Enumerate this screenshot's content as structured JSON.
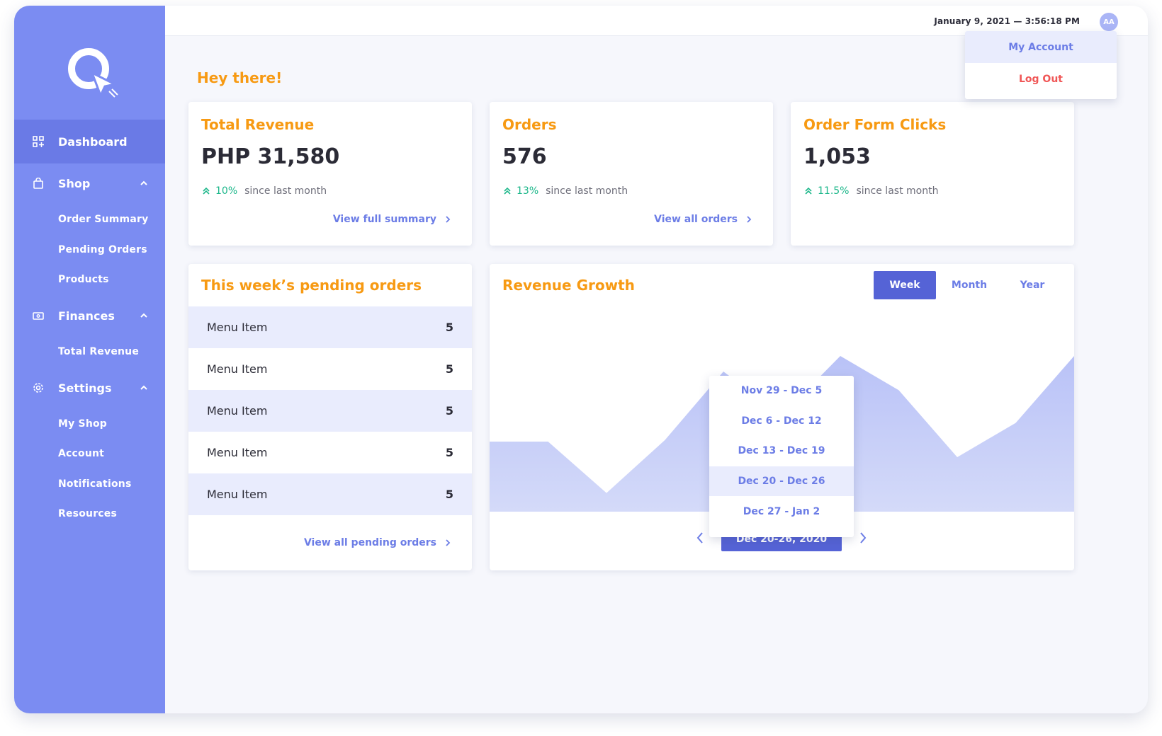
{
  "sidebar": {
    "items": [
      {
        "label": "Dashboard",
        "icon": "dashboard-icon"
      },
      {
        "label": "Shop",
        "icon": "shopping-bag-icon",
        "sub": [
          "Order Summary",
          "Pending Orders",
          "Products"
        ]
      },
      {
        "label": "Finances",
        "icon": "wallet-icon",
        "sub": [
          "Total Revenue"
        ]
      },
      {
        "label": "Settings",
        "icon": "gear-icon",
        "sub": [
          "My Shop",
          "Account",
          "Notifications",
          "Resources"
        ]
      }
    ]
  },
  "topbar": {
    "date": "January 9, 2021",
    "separator": "—",
    "time": "3:56:18 PM",
    "avatar_initials": "AA",
    "account_menu": {
      "my_account": "My Account",
      "log_out": "Log Out"
    }
  },
  "greeting": "Hey there!",
  "stats": [
    {
      "title": "Total Revenue",
      "value": "PHP 31,580",
      "change": "10%",
      "since": "since last month",
      "link": "View full summary"
    },
    {
      "title": "Orders",
      "value": "576",
      "change": "13%",
      "since": "since last month",
      "link": "View all orders"
    },
    {
      "title": "Order Form Clicks",
      "value": "1,053",
      "change": "11.5%",
      "since": "since last month",
      "link": ""
    }
  ],
  "pending": {
    "title": "This week’s pending orders",
    "rows": [
      {
        "name": "Menu Item",
        "count": "5"
      },
      {
        "name": "Menu Item",
        "count": "5"
      },
      {
        "name": "Menu Item",
        "count": "5"
      },
      {
        "name": "Menu Item",
        "count": "5"
      },
      {
        "name": "Menu Item",
        "count": "5"
      }
    ],
    "link": "View all pending orders"
  },
  "revenue": {
    "title": "Revenue Growth",
    "periods": [
      "Week",
      "Month",
      "Year"
    ],
    "active_period": "Week",
    "week_options": [
      "Nov 29 - Dec 5",
      "Dec 6 - Dec 12",
      "Dec 13 - Dec 19",
      "Dec 20 - Dec 26",
      "Dec 27 - Jan 2"
    ],
    "selected_week": "Dec 20 - Dec 26",
    "date_button": "Dec 20-26, 2020"
  },
  "chart_data": {
    "type": "area",
    "x": [
      0,
      1,
      2,
      3,
      4,
      5,
      6,
      7,
      8,
      9
    ],
    "values": [
      0.45,
      0.45,
      0.12,
      0.46,
      0.9,
      0.62,
      1.0,
      0.78,
      0.35,
      0.57,
      1.0
    ],
    "title": "Revenue Growth",
    "color": "#c6cdf8",
    "grid": false
  },
  "colors": {
    "accent": "#7b8cf2",
    "orange": "#f79a13",
    "green": "#1cb78a",
    "red": "#f05656"
  }
}
